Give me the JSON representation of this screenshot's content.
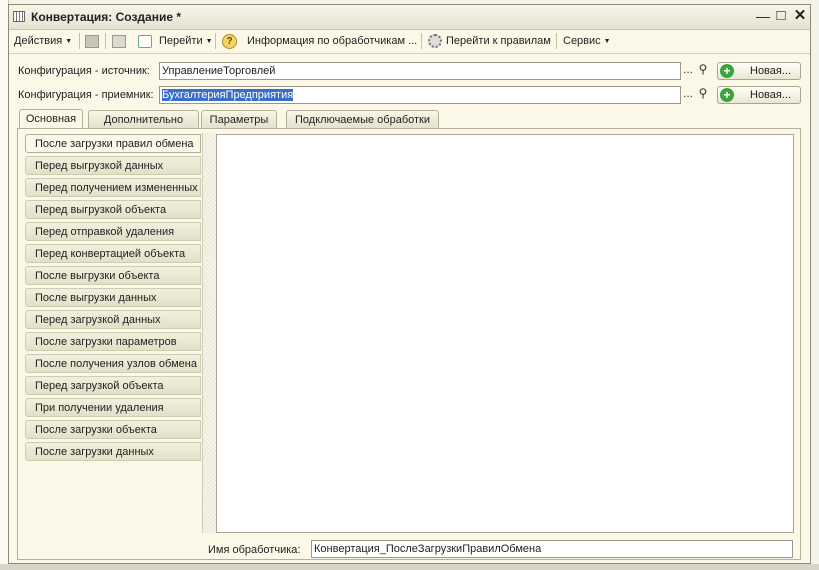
{
  "window": {
    "title": "Конвертация: Создание *"
  },
  "toolbar": {
    "actions_label": "Действия",
    "goto_label": "Перейти",
    "handler_info_label": "Информация по обработчикам ...",
    "goto_rules_label": "Перейти к правилам",
    "service_label": "Сервис"
  },
  "form": {
    "source_label": "Конфигурация - источник:",
    "source_value": "УправлениеТорговлей",
    "target_label": "Конфигурация - приемник:",
    "target_value": "БухгалтерияПредприятия",
    "ellipsis": "...",
    "new_button_label": "Новая..."
  },
  "tabs": [
    "Основная",
    "Дополнительно",
    "Параметры",
    "Подключаемые обработки"
  ],
  "handlers": [
    "После загрузки правил обмена",
    "Перед выгрузкой данных",
    "Перед получением измененных",
    "Перед выгрузкой объекта",
    "Перед отправкой удаления",
    "Перед конвертацией объекта",
    "После выгрузки объекта",
    "После выгрузки данных",
    "Перед загрузкой данных",
    "После загрузки параметров",
    "После получения узлов обмена",
    "Перед загрузкой объекта",
    "При получении удаления",
    "После загрузки объекта",
    "После загрузки данных"
  ],
  "handler_name": {
    "label": "Имя обработчика:",
    "value": "Конвертация_ПослеЗагрузкиПравилОбмена"
  },
  "colors": {
    "selection": "#3a6fc8",
    "add_icon": "#3aa43a"
  }
}
